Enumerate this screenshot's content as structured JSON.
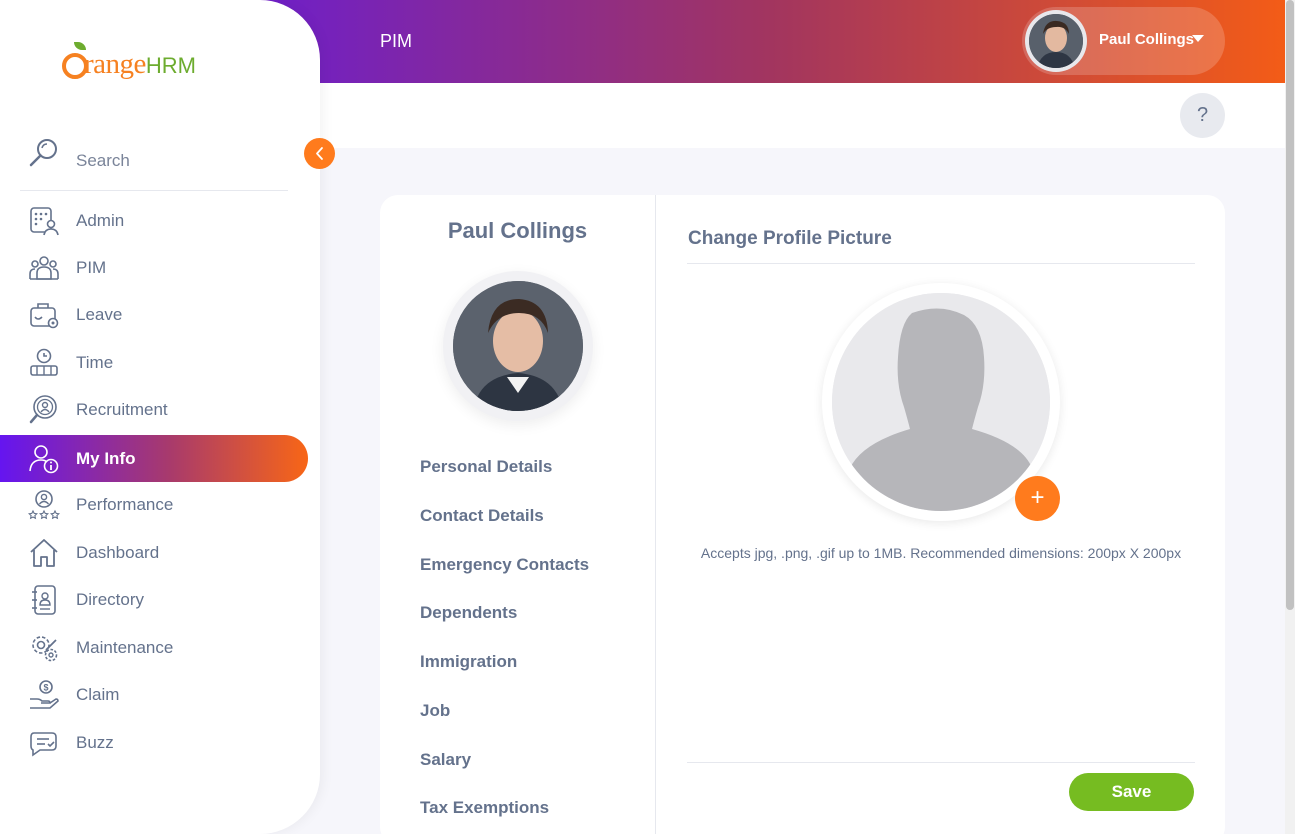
{
  "header": {
    "module_title": "PIM",
    "user_name": "Paul Collings"
  },
  "help": {
    "label": "?"
  },
  "brand": {
    "logo_word": "range",
    "logo_hrm": "HRM"
  },
  "sidebar": {
    "search_label": "Search",
    "items": [
      {
        "label": "Admin",
        "icon": "admin-icon"
      },
      {
        "label": "PIM",
        "icon": "pim-icon"
      },
      {
        "label": "Leave",
        "icon": "leave-icon"
      },
      {
        "label": "Time",
        "icon": "time-icon"
      },
      {
        "label": "Recruitment",
        "icon": "recruitment-icon"
      },
      {
        "label": "My Info",
        "icon": "my-info-icon",
        "active": true
      },
      {
        "label": "Performance",
        "icon": "performance-icon"
      },
      {
        "label": "Dashboard",
        "icon": "dashboard-icon"
      },
      {
        "label": "Directory",
        "icon": "directory-icon"
      },
      {
        "label": "Maintenance",
        "icon": "maintenance-icon"
      },
      {
        "label": "Claim",
        "icon": "claim-icon"
      },
      {
        "label": "Buzz",
        "icon": "buzz-icon"
      }
    ]
  },
  "profile": {
    "name": "Paul Collings",
    "tabs": [
      "Personal Details",
      "Contact Details",
      "Emergency Contacts",
      "Dependents",
      "Immigration",
      "Job",
      "Salary",
      "Tax Exemptions"
    ]
  },
  "picture": {
    "title": "Change Profile Picture",
    "add_label": "+",
    "hint": "Accepts jpg, .png, .gif up to 1MB. Recommended dimensions: 200px X 200px",
    "save_label": "Save"
  },
  "colors": {
    "accent_orange": "#ff7b1d",
    "save_green": "#76bc21",
    "active_gradient_start": "#6515f0",
    "active_gradient_end": "#f86616"
  }
}
